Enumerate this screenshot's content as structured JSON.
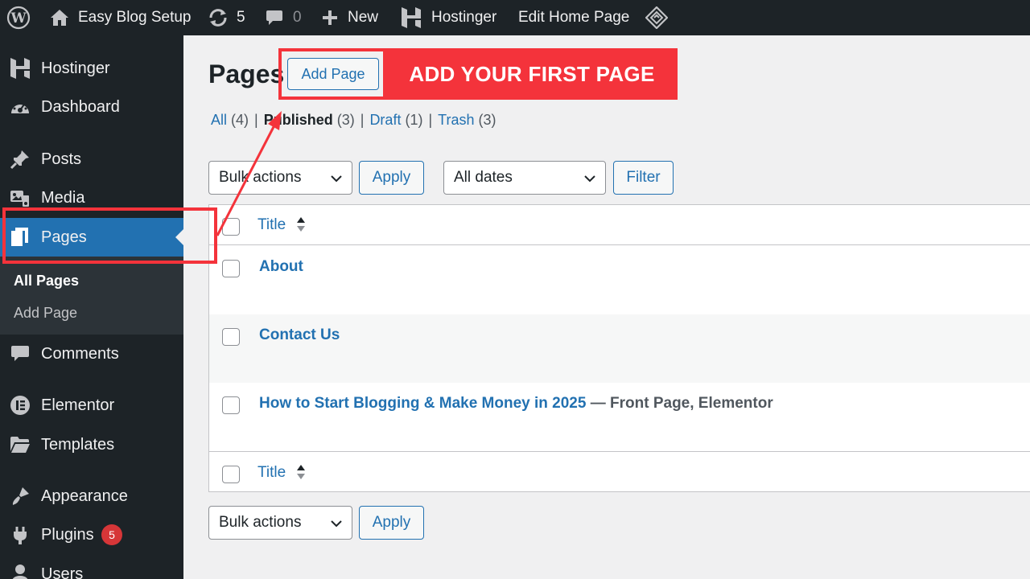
{
  "adminbar": {
    "site_name": "Easy Blog Setup",
    "updates_count": "5",
    "comments_count": "0",
    "new_label": "New",
    "hostinger_label": "Hostinger",
    "edit_label": "Edit Home Page"
  },
  "sidebar": {
    "items": [
      {
        "label": "Hostinger",
        "icon": "hostinger-icon"
      },
      {
        "label": "Dashboard",
        "icon": "dashboard-icon"
      },
      {
        "label": "Posts",
        "icon": "pin-icon"
      },
      {
        "label": "Media",
        "icon": "media-icon"
      },
      {
        "label": "Pages",
        "icon": "pages-icon"
      },
      {
        "label": "Comments",
        "icon": "comment-icon"
      },
      {
        "label": "Elementor",
        "icon": "elementor-icon"
      },
      {
        "label": "Templates",
        "icon": "folder-icon"
      },
      {
        "label": "Appearance",
        "icon": "brush-icon"
      },
      {
        "label": "Plugins",
        "icon": "plugin-icon"
      },
      {
        "label": "Users",
        "icon": "user-icon"
      }
    ],
    "submenu": [
      "All Pages",
      "Add Page"
    ],
    "plugins_badge": "5"
  },
  "main": {
    "title": "Pages",
    "add_page_label": "Add Page",
    "callout": "ADD YOUR FIRST PAGE",
    "filters": [
      {
        "label": "All",
        "count": "(4)"
      },
      {
        "label": "Published",
        "count": "(3)"
      },
      {
        "label": "Draft",
        "count": "(1)"
      },
      {
        "label": "Trash",
        "count": "(3)"
      }
    ],
    "separator": "|",
    "bulk_actions": "Bulk actions",
    "apply_label": "Apply",
    "dates_select": "All dates",
    "filter_label": "Filter",
    "column_title": "Title",
    "rows": [
      {
        "title": "About",
        "state": ""
      },
      {
        "title": "Contact Us",
        "state": ""
      },
      {
        "title": "How to Start Blogging & Make Money in 2025",
        "state": " — Front Page, Elementor"
      }
    ]
  },
  "colors": {
    "admin_dark": "#1d2327",
    "wp_blue": "#2271b1",
    "callout_red": "#f4333b"
  }
}
